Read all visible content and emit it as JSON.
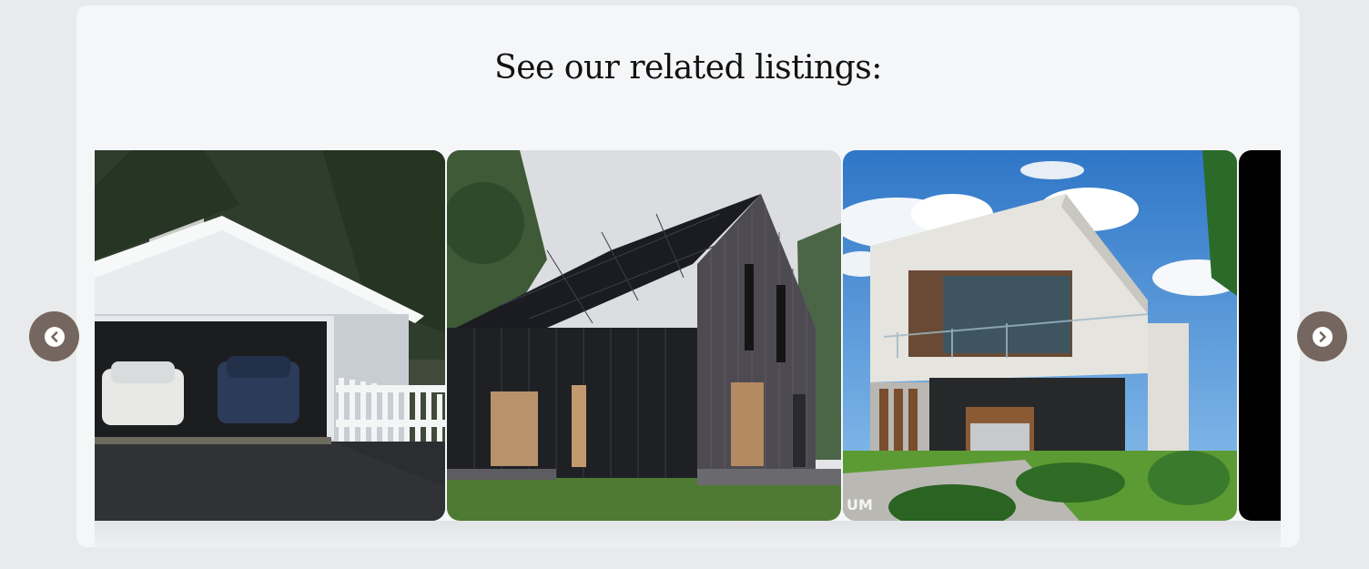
{
  "related": {
    "heading": "See our related listings:"
  },
  "carousel": {
    "prev_icon": "chevron-left-circle-icon",
    "next_icon": "chevron-right-circle-icon",
    "accent_color": "#75675f",
    "cards": [
      {
        "image": "white-garage-with-picket-fence"
      },
      {
        "image": "black-scandinavian-house-solar-roof"
      },
      {
        "image": "modern-white-two-story-house-with-balcony",
        "watermark": "UM"
      },
      {
        "image": "black-partial-card"
      }
    ]
  }
}
